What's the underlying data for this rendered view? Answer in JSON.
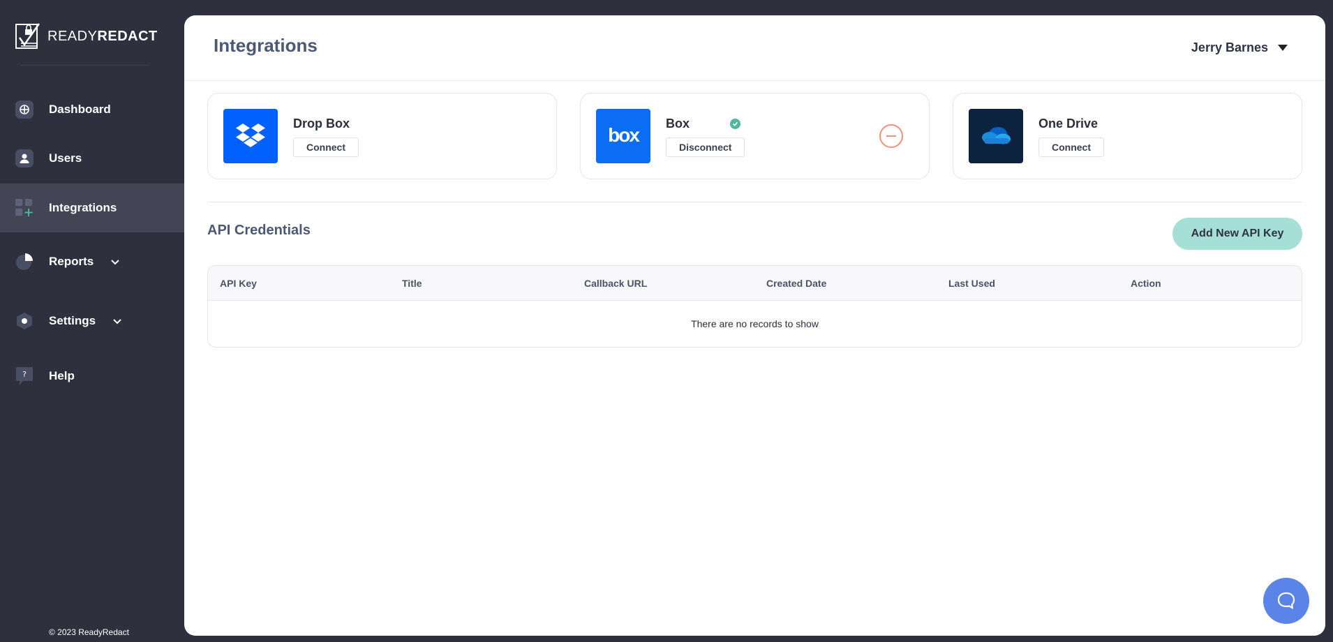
{
  "app": {
    "brand_light": "READY",
    "brand_bold": "REDACT",
    "copyright": "© 2023 ReadyRedact"
  },
  "sidebar": {
    "items": [
      {
        "label": "Dashboard",
        "icon": "dashboard-icon"
      },
      {
        "label": "Users",
        "icon": "user-icon"
      },
      {
        "label": "Integrations",
        "icon": "integrations-icon",
        "active": true
      },
      {
        "label": "Reports",
        "icon": "reports-icon",
        "expandable": true
      },
      {
        "label": "Settings",
        "icon": "settings-icon",
        "expandable": true
      },
      {
        "label": "Help",
        "icon": "help-icon"
      }
    ]
  },
  "header": {
    "title": "Integrations",
    "user_name": "Jerry Barnes"
  },
  "integrations": [
    {
      "name": "Drop Box",
      "button": "Connect",
      "connected": false,
      "logo": "dropbox-logo",
      "color": "#0061fe"
    },
    {
      "name": "Box",
      "button": "Disconnect",
      "connected": true,
      "logo": "box-logo",
      "color": "#0b6cf4"
    },
    {
      "name": "One Drive",
      "button": "Connect",
      "connected": false,
      "logo": "onedrive-logo",
      "color": "#0c2340"
    }
  ],
  "api": {
    "title": "API Credentials",
    "add_button": "Add New API Key",
    "columns": [
      "API Key",
      "Title",
      "Callback URL",
      "Created Date",
      "Last Used",
      "Action"
    ],
    "empty_message": "There are no records to show"
  },
  "colors": {
    "sidebar_bg": "#2e303d",
    "accent_teal": "#a6dfd7",
    "verified": "#4fb7a0",
    "remove": "#f2907a",
    "chat": "#5a84e8"
  }
}
